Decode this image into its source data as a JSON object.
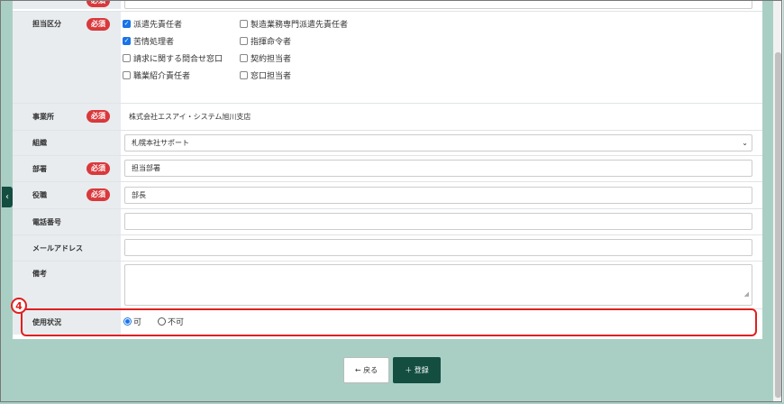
{
  "form": {
    "required_label": "必須",
    "tantou": {
      "label": "担当区分",
      "options": [
        {
          "label": "派遣先責任者",
          "checked": true
        },
        {
          "label": "製造業務専門派遣先責任者",
          "checked": false
        },
        {
          "label": "苦情処理者",
          "checked": true
        },
        {
          "label": "指揮命令者",
          "checked": false
        },
        {
          "label": "請求に関する問合せ窓口",
          "checked": false
        },
        {
          "label": "契約担当者",
          "checked": false
        },
        {
          "label": "職業紹介責任者",
          "checked": false
        },
        {
          "label": "窓口担当者",
          "checked": false
        }
      ]
    },
    "office": {
      "label": "事業所",
      "value": "株式会社エスアイ・システム旭川支店"
    },
    "org": {
      "label": "組織",
      "value": "札幌本社サポート"
    },
    "dept": {
      "label": "部署",
      "value": "担当部署"
    },
    "position": {
      "label": "役職",
      "value": "部長"
    },
    "phone": {
      "label": "電話番号",
      "value": ""
    },
    "email": {
      "label": "メールアドレス",
      "value": ""
    },
    "notes": {
      "label": "備考",
      "value": ""
    },
    "status": {
      "label": "使用状況",
      "options": [
        "可",
        "不可"
      ],
      "selected": "可"
    }
  },
  "buttons": {
    "back": "← 戻る",
    "register": "＋ 登録"
  },
  "annotation": {
    "number": "4",
    "color": "#e02020"
  }
}
